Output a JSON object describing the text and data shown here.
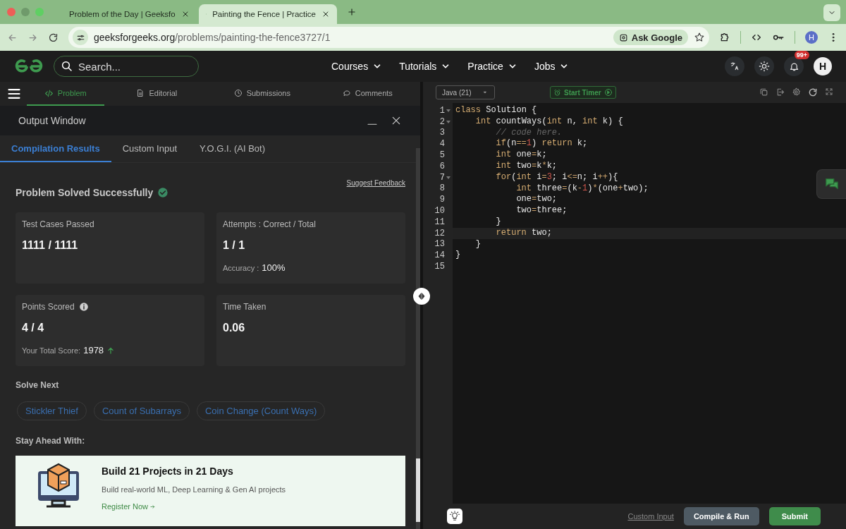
{
  "browser": {
    "tabs": [
      {
        "title": "Problem of the Day | Geeksfo",
        "selected": false
      },
      {
        "title": "Painting the Fence | Practice",
        "selected": true
      }
    ],
    "url_host": "geeksforgeeks.org",
    "url_path": "/problems/painting-the-fence3727/1",
    "ask_button": "Ask Google",
    "profile": "H"
  },
  "site_header": {
    "search_placeholder": "Search...",
    "nav": [
      "Courses",
      "Tutorials",
      "Practice",
      "Jobs"
    ],
    "notification_badge": "99+",
    "avatar": "H"
  },
  "problem_tabs": [
    {
      "label": "Problem",
      "selected": true
    },
    {
      "label": "Editorial",
      "selected": false
    },
    {
      "label": "Submissions",
      "selected": false
    },
    {
      "label": "Comments",
      "selected": false
    }
  ],
  "output_window": {
    "title": "Output Window",
    "tabs": [
      {
        "label": "Compilation Results",
        "selected": true
      },
      {
        "label": "Custom Input",
        "selected": false
      },
      {
        "label": "Y.O.G.I. (AI Bot)",
        "selected": false
      }
    ],
    "status": "Problem Solved Successfully",
    "feedback_link": "Suggest Feedback",
    "cards": [
      {
        "label": "Test Cases Passed",
        "value": "1111 / 1111"
      },
      {
        "label": "Attempts : Correct / Total",
        "value": "1 / 1",
        "detail_label": "Accuracy :",
        "detail_value": "100%"
      },
      {
        "label": "Points Scored",
        "info": true,
        "value": "4 / 4",
        "detail_label": "Your Total Score:",
        "detail_value": "1978",
        "rising": true
      },
      {
        "label": "Time Taken",
        "value": "0.06"
      }
    ],
    "solve_next_title": "Solve Next",
    "solve_next": [
      "Stickler Thief",
      "Count of Subarrays",
      "Coin Change (Count Ways)"
    ],
    "stay_ahead_title": "Stay Ahead With:",
    "promo": {
      "title": "Build 21 Projects in 21 Days",
      "description": "Build real-world ML, Deep Learning & Gen AI projects",
      "link": "Register Now"
    }
  },
  "editor": {
    "language": "Java (21)",
    "timer_button": "Start Timer",
    "lines": [
      {
        "n": "1",
        "fold": true,
        "active": false,
        "tokens": [
          {
            "kind": "kw",
            "text": "class"
          },
          {
            "kind": "p",
            "text": " Solution {"
          }
        ]
      },
      {
        "n": "2",
        "fold": true,
        "active": false,
        "tokens": [
          {
            "kind": "kw",
            "text": "    int"
          },
          {
            "kind": "p",
            "text": " countWays("
          },
          {
            "kind": "kw",
            "text": "int"
          },
          {
            "kind": "p",
            "text": " n, "
          },
          {
            "kind": "kw",
            "text": "int"
          },
          {
            "kind": "p",
            "text": " k) {"
          }
        ]
      },
      {
        "n": "3",
        "fold": false,
        "active": false,
        "tokens": [
          {
            "kind": "cm",
            "text": "        // code here."
          }
        ]
      },
      {
        "n": "4",
        "fold": false,
        "active": false,
        "tokens": [
          {
            "kind": "kw",
            "text": "        if"
          },
          {
            "kind": "p",
            "text": "(n"
          },
          {
            "kind": "op",
            "text": "=="
          },
          {
            "kind": "num",
            "text": "1"
          },
          {
            "kind": "p",
            "text": ") "
          },
          {
            "kind": "kw",
            "text": "return"
          },
          {
            "kind": "p",
            "text": " k;"
          }
        ]
      },
      {
        "n": "5",
        "fold": false,
        "active": false,
        "tokens": [
          {
            "kind": "kw",
            "text": "        int"
          },
          {
            "kind": "p",
            "text": " one"
          },
          {
            "kind": "op",
            "text": "="
          },
          {
            "kind": "p",
            "text": "k;"
          }
        ]
      },
      {
        "n": "6",
        "fold": false,
        "active": false,
        "tokens": [
          {
            "kind": "kw",
            "text": "        int"
          },
          {
            "kind": "p",
            "text": " two"
          },
          {
            "kind": "op",
            "text": "="
          },
          {
            "kind": "p",
            "text": "k"
          },
          {
            "kind": "op",
            "text": "*"
          },
          {
            "kind": "p",
            "text": "k;"
          }
        ]
      },
      {
        "n": "7",
        "fold": true,
        "active": false,
        "tokens": [
          {
            "kind": "kw",
            "text": "        for"
          },
          {
            "kind": "p",
            "text": "("
          },
          {
            "kind": "kw",
            "text": "int"
          },
          {
            "kind": "p",
            "text": " i"
          },
          {
            "kind": "op",
            "text": "="
          },
          {
            "kind": "num",
            "text": "3"
          },
          {
            "kind": "p",
            "text": "; i"
          },
          {
            "kind": "op",
            "text": "<="
          },
          {
            "kind": "p",
            "text": "n; i"
          },
          {
            "kind": "op",
            "text": "++"
          },
          {
            "kind": "p",
            "text": "){"
          }
        ]
      },
      {
        "n": "8",
        "fold": false,
        "active": false,
        "tokens": [
          {
            "kind": "kw",
            "text": "            int"
          },
          {
            "kind": "p",
            "text": " three"
          },
          {
            "kind": "op",
            "text": "="
          },
          {
            "kind": "p",
            "text": "(k"
          },
          {
            "kind": "op",
            "text": "-"
          },
          {
            "kind": "num",
            "text": "1"
          },
          {
            "kind": "p",
            "text": ")"
          },
          {
            "kind": "op",
            "text": "*"
          },
          {
            "kind": "p",
            "text": "(one"
          },
          {
            "kind": "op",
            "text": "+"
          },
          {
            "kind": "p",
            "text": "two);"
          }
        ]
      },
      {
        "n": "9",
        "fold": false,
        "active": false,
        "tokens": [
          {
            "kind": "p",
            "text": "            one"
          },
          {
            "kind": "op",
            "text": "="
          },
          {
            "kind": "p",
            "text": "two;"
          }
        ]
      },
      {
        "n": "10",
        "fold": false,
        "active": false,
        "tokens": [
          {
            "kind": "p",
            "text": "            two"
          },
          {
            "kind": "op",
            "text": "="
          },
          {
            "kind": "p",
            "text": "three;"
          }
        ]
      },
      {
        "n": "11",
        "fold": false,
        "active": false,
        "tokens": [
          {
            "kind": "p",
            "text": "        }"
          }
        ]
      },
      {
        "n": "12",
        "fold": false,
        "active": true,
        "tokens": [
          {
            "kind": "kw",
            "text": "        return"
          },
          {
            "kind": "p",
            "text": " two;"
          }
        ]
      },
      {
        "n": "13",
        "fold": false,
        "active": false,
        "tokens": [
          {
            "kind": "p",
            "text": "    }"
          }
        ]
      },
      {
        "n": "14",
        "fold": false,
        "active": false,
        "tokens": [
          {
            "kind": "p",
            "text": "}"
          }
        ]
      },
      {
        "n": "15",
        "fold": false,
        "active": false
      }
    ],
    "custom_input_link": "Custom Input",
    "run_button": "Compile & Run",
    "submit_button": "Submit"
  }
}
